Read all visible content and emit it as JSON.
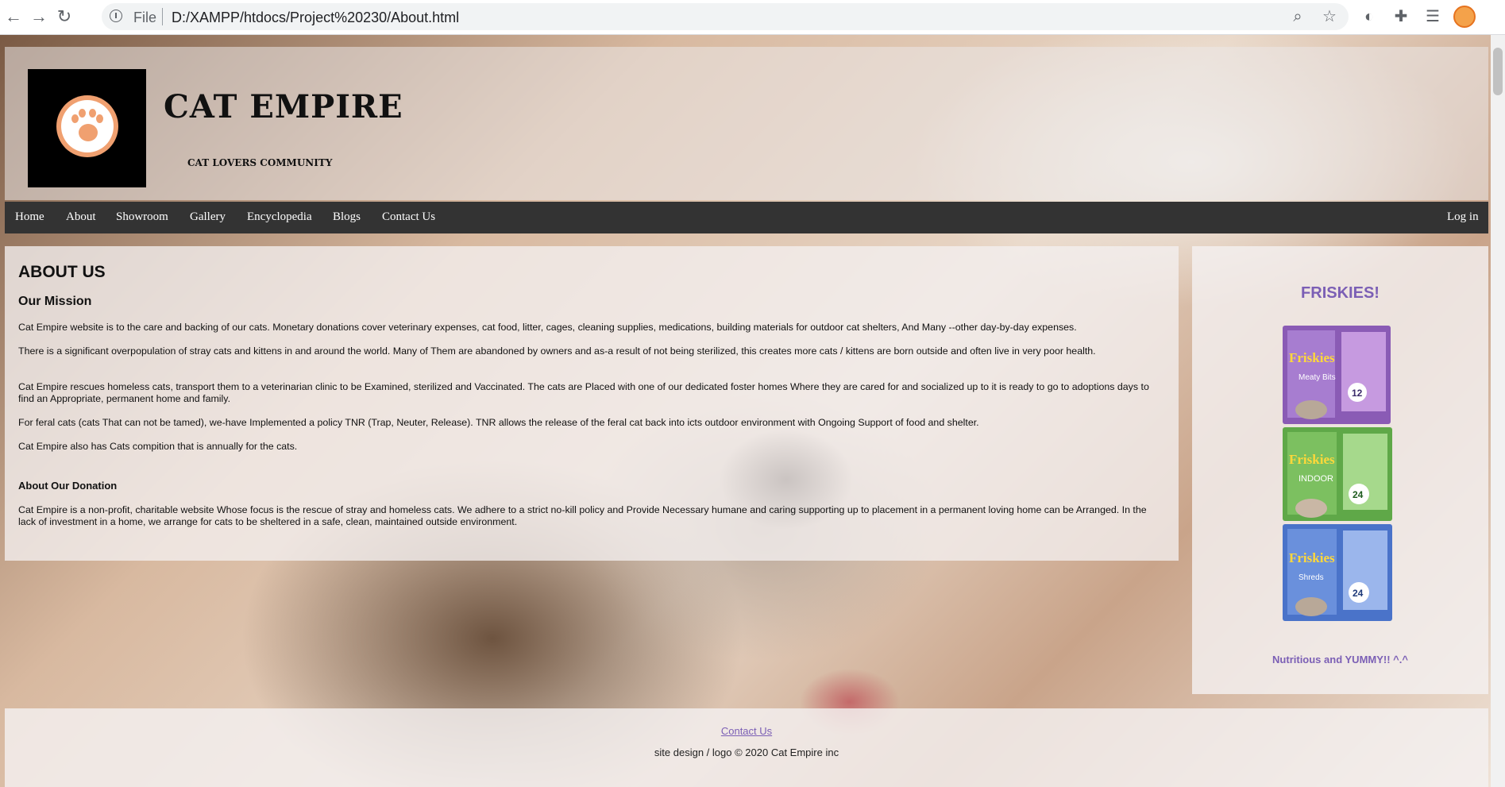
{
  "browser": {
    "back_icon": "arrow-left-icon",
    "forward_icon": "arrow-right-icon",
    "reload_icon": "reload-icon",
    "site_info_icon": "info-icon",
    "scheme_label": "File",
    "url": "D:/XAMPP/htdocs/Project%20230/About.html",
    "toolbar_icons": [
      "zoom-icon",
      "star-icon",
      "extension-circle-icon",
      "puzzle-icon",
      "reading-list-icon",
      "profile-avatar"
    ]
  },
  "header": {
    "title": "CAT EMPIRE",
    "tagline": "CAT LOVERS COMMUNITY",
    "logo_icon": "paw-icon",
    "logo_colors": {
      "background": "#000000",
      "ring": "#f0a070"
    }
  },
  "nav": {
    "items": [
      {
        "label": "Home"
      },
      {
        "label": "About"
      },
      {
        "label": "Showroom"
      },
      {
        "label": "Gallery"
      },
      {
        "label": "Encyclopedia"
      },
      {
        "label": "Blogs"
      },
      {
        "label": "Contact Us"
      }
    ],
    "login_label": "Log in"
  },
  "main": {
    "heading": "ABOUT US",
    "mission_heading": "Our Mission",
    "paragraphs": [
      "Cat Empire website is to the care and backing of our cats. Monetary donations cover veterinary expenses, cat food, litter, cages, cleaning supplies, medications, building materials for outdoor cat shelters, And Many --other day-by-day expenses.",
      "There is a significant overpopulation of stray cats and kittens in and around the world. Many of Them are abandoned by owners and as-a result of not being sterilized, this creates more cats / kittens are born outside and often live in very poor health.",
      "Cat Empire rescues homeless cats, transport them to a veterinarian clinic to be Examined, sterilized and Vaccinated. The cats are Placed with one of our dedicated foster homes Where they are cared for and socialized up to it is ready to go to adoptions days to find an Appropriate, permanent home and family.",
      "For feral cats (cats That can not be tamed), we-have Implemented a policy TNR (Trap, Neuter, Release). TNR allows the release of the feral cat back into icts outdoor environment with Ongoing Support of food and shelter.",
      "Cat Empire also has Cats compition that is annually for the cats."
    ],
    "donation_heading": "About Our Donation",
    "donation_text": "Cat Empire is a non-profit, charitable website Whose focus is the rescue of stray and homeless cats. We adhere to a strict no-kill policy and Provide Necessary humane and caring supporting up to placement in a permanent loving home can be Arranged. In the lack of investment in a home, we arrange for cats to be sheltered in a safe, clean, maintained outside environment."
  },
  "sidebar": {
    "title": "FRISKIES!",
    "product_boxes": [
      {
        "brand": "Friskies",
        "variant": "Meaty Bits",
        "count": "12",
        "color": "#8a5bb5"
      },
      {
        "brand": "Friskies",
        "variant": "INDOOR",
        "count": "24",
        "color": "#5fa848"
      },
      {
        "brand": "Friskies",
        "variant": "Shreds",
        "count": "24",
        "color": "#4a73c9"
      }
    ],
    "caption": "Nutritious and YUMMY!! ^.^"
  },
  "footer": {
    "contact_link": "Contact Us",
    "copyright": "site design / logo © 2020 Cat Empire inc"
  }
}
